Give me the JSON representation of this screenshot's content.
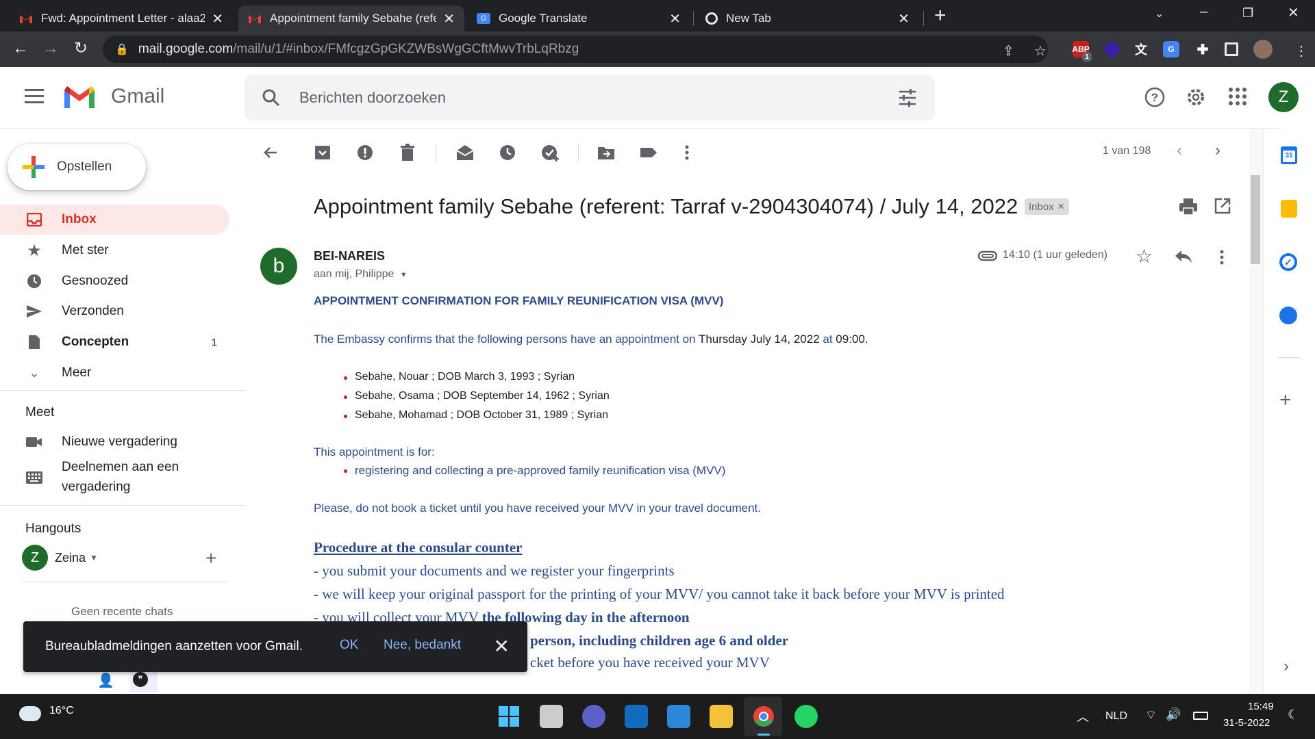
{
  "browser": {
    "tabs": [
      {
        "title": "Fwd: Appointment Letter - alaa2",
        "active": false
      },
      {
        "title": "Appointment family Sebahe (refe",
        "active": true
      },
      {
        "title": "Google Translate",
        "active": false
      },
      {
        "title": "New Tab",
        "active": false
      }
    ],
    "url_host": "mail.google.com",
    "url_path": "/mail/u/1/#inbox/FMfcgzGpGKZWBsWgGCftMwvTrbLqRbzg",
    "ext_badge": "1"
  },
  "gmail": {
    "logo_text": "Gmail",
    "search_placeholder": "Berichten doorzoeken",
    "avatar_letter": "Z"
  },
  "nav": {
    "compose": "Opstellen",
    "items": [
      {
        "label": "Inbox",
        "icon": "inbox-icon"
      },
      {
        "label": "Met ster",
        "icon": "star-icon"
      },
      {
        "label": "Gesnoozed",
        "icon": "clock-icon"
      },
      {
        "label": "Verzonden",
        "icon": "send-icon"
      },
      {
        "label": "Concepten",
        "icon": "file-icon",
        "count": "1"
      },
      {
        "label": "Meer",
        "icon": "chevron-down-icon"
      }
    ],
    "meet_title": "Meet",
    "meet_new": "Nieuwe vergadering",
    "meet_join_1": "Deelnemen aan een",
    "meet_join_2": "vergadering",
    "hangouts_title": "Hangouts",
    "hangouts_user": "Zeina",
    "hangouts_user_letter": "Z",
    "no_recent": "Geen recente chats"
  },
  "toolbar": {
    "pager": "1 van 198"
  },
  "message": {
    "subject": "Appointment family Sebahe (referent: Tarraf v-2904304074) / July 14, 2022",
    "label_chip": "Inbox",
    "sender_letter": "b",
    "sender": "BEI-NAREIS",
    "recipients": "aan mij, Philippe",
    "time": "14:10 (1 uur geleden)",
    "heading": "APPOINTMENT CONFIRMATION FOR FAMILY REUNIFICATION VISA (MVV)",
    "intro_a": "The Embassy confirms that the following persons have an appointment on ",
    "intro_date": "Thursday July 14, 2022",
    "intro_b": " at ",
    "intro_time": "09:00",
    "intro_c": ".",
    "persons": [
      "Sebahe, Nouar ; DOB March 3, 1993 ; Syrian",
      "Sebahe, Osama ; DOB September 14, 1962 ; Syrian",
      "Sebahe, Mohamad ; DOB October 31, 1989 ; Syrian"
    ],
    "purpose_title": "This appointment is for:",
    "purpose_item": "registering and collecting a pre-approved family reunification visa (MVV)",
    "no_ticket": "Please, do not book a ticket until you have received your MVV in your travel document.",
    "procedure_title": "Procedure at the consular counter",
    "proc_1": "- you submit your documents and we register your fingerprints",
    "proc_2": "- we will keep your original passport for the printing of your MVV/ you cannot take it back before your MVV is printed",
    "proc_3a": "- you will collect your MVV ",
    "proc_3b": "the following day in the afternoon",
    "proc_4": "person, including children age 6 and older",
    "proc_5": "cket before you have received your MVV"
  },
  "snackbar": {
    "message": "Bureaubladmeldingen aanzetten voor Gmail.",
    "ok": "OK",
    "no": "Nee, bedankt"
  },
  "taskbar": {
    "temperature": "16°C",
    "language": "NLD",
    "time": "15:49",
    "date": "31-5-2022"
  },
  "colors": {
    "gmail_red": "#d93025",
    "body_blue": "#2c4a8a",
    "avatar_green": "#1e6b2b"
  }
}
